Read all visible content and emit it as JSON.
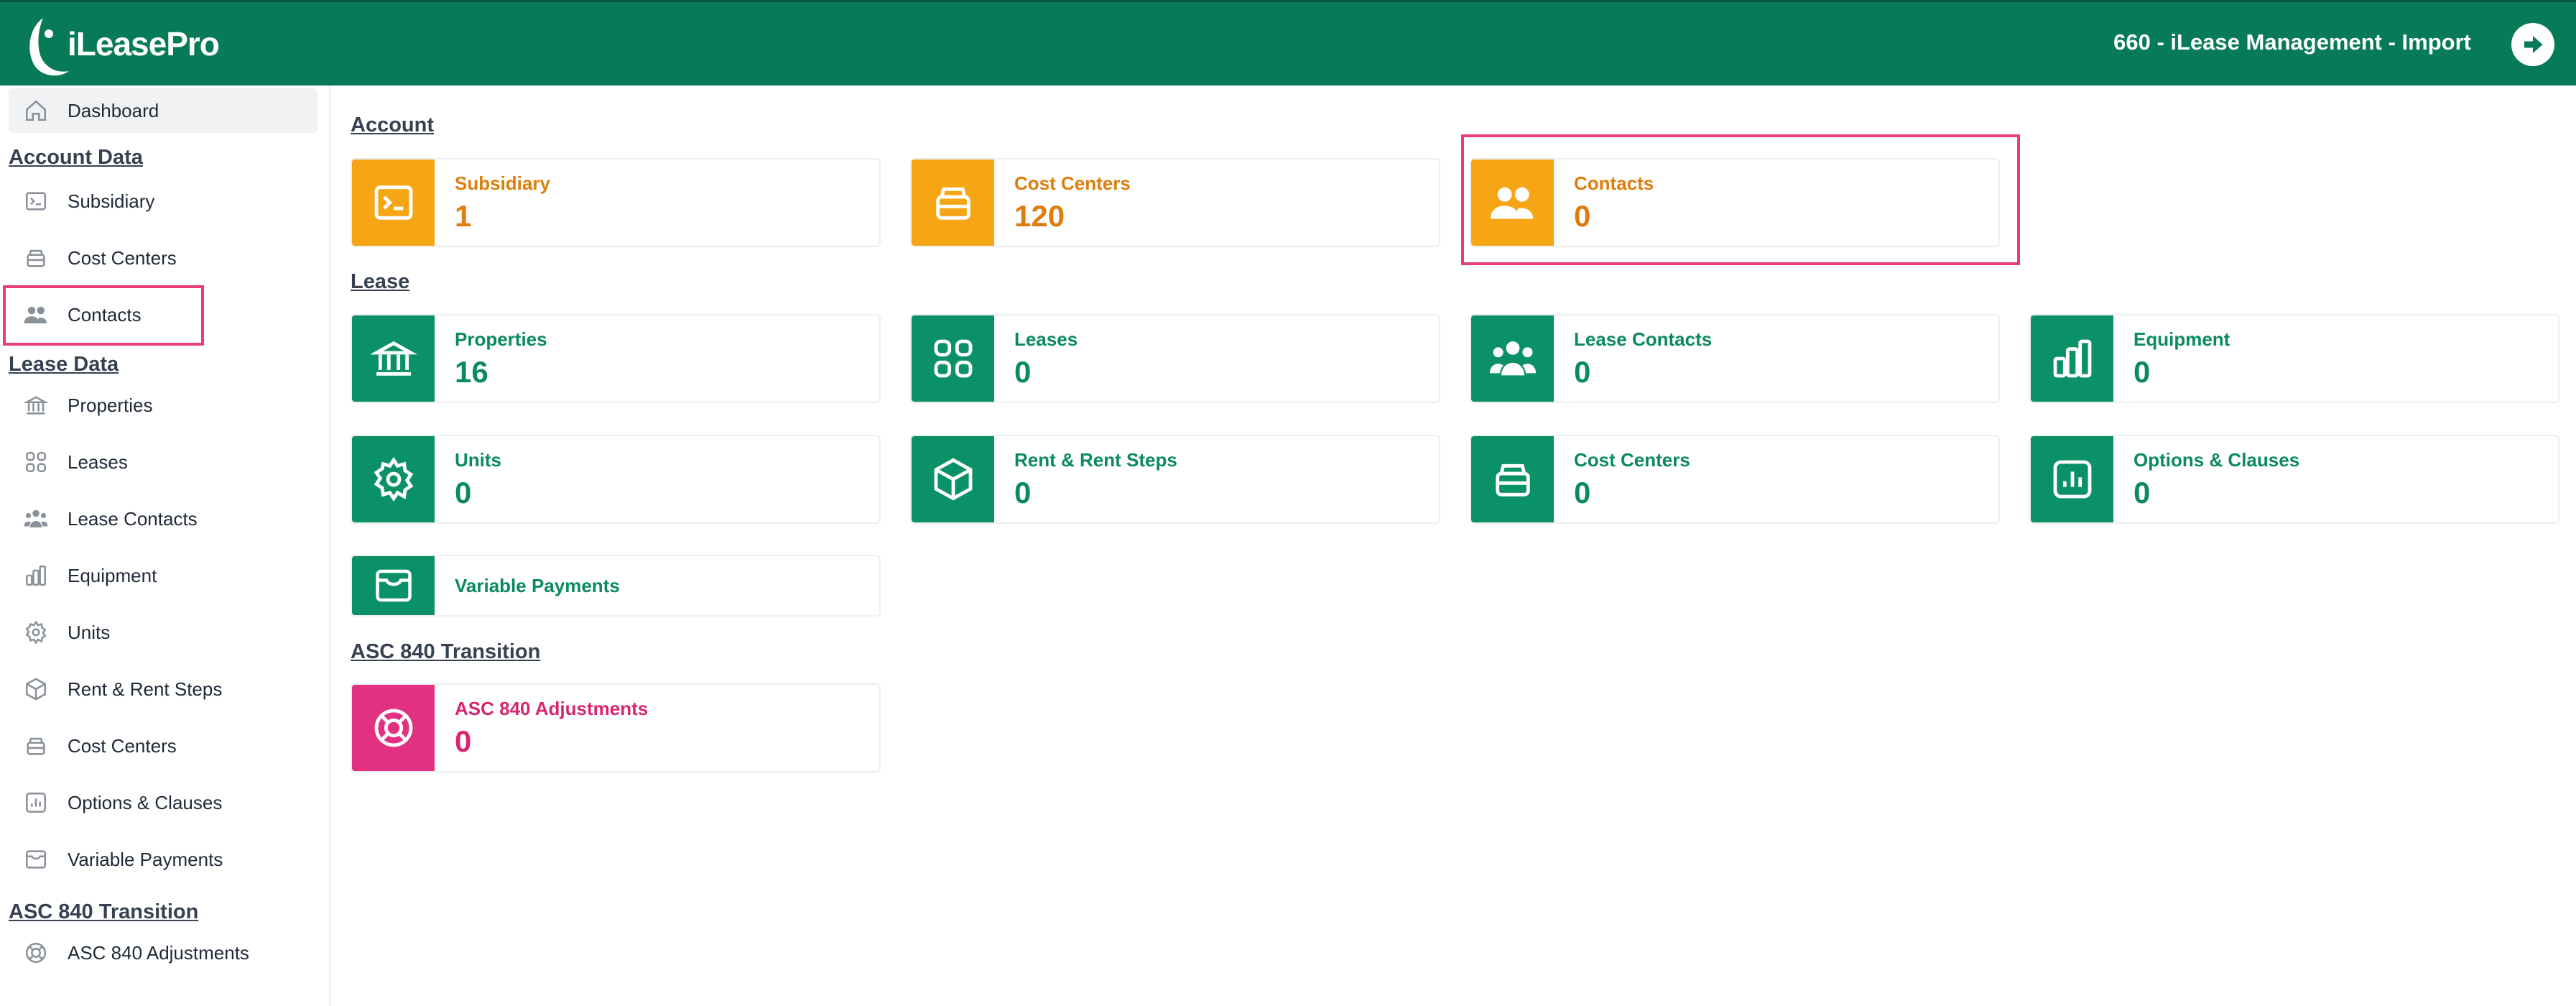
{
  "header": {
    "brand": "iLeasePro",
    "account_title": "660 - iLease Management - Import"
  },
  "sidebar": {
    "dashboard": "Dashboard",
    "account_heading": "Account Data",
    "account_items": [
      "Subsidiary",
      "Cost Centers",
      "Contacts"
    ],
    "lease_heading": "Lease Data",
    "lease_items": [
      "Properties",
      "Leases",
      "Lease Contacts",
      "Equipment",
      "Units",
      "Rent & Rent Steps",
      "Cost Centers",
      "Options & Clauses",
      "Variable Payments"
    ],
    "asc_heading": "ASC 840 Transition",
    "asc_items": [
      "ASC 840 Adjustments"
    ]
  },
  "main": {
    "account_title": "Account",
    "account_cards": [
      {
        "label": "Subsidiary",
        "value": "1",
        "icon": "terminal-icon"
      },
      {
        "label": "Cost Centers",
        "value": "120",
        "icon": "archive-icon"
      },
      {
        "label": "Contacts",
        "value": "0",
        "icon": "people-icon"
      }
    ],
    "lease_title": "Lease",
    "lease_cards": [
      {
        "label": "Properties",
        "value": "16",
        "icon": "bank-icon"
      },
      {
        "label": "Leases",
        "value": "0",
        "icon": "grid-icon"
      },
      {
        "label": "Lease Contacts",
        "value": "0",
        "icon": "group-icon"
      },
      {
        "label": "Equipment",
        "value": "0",
        "icon": "bar-chart-icon"
      },
      {
        "label": "Units",
        "value": "0",
        "icon": "gear-icon"
      },
      {
        "label": "Rent & Rent Steps",
        "value": "0",
        "icon": "box-icon"
      },
      {
        "label": "Cost Centers",
        "value": "0",
        "icon": "archive-icon"
      },
      {
        "label": "Options & Clauses",
        "value": "0",
        "icon": "chart-square-icon"
      },
      {
        "label": "Variable Payments",
        "icon": "wallet-icon"
      }
    ],
    "asc_title": "ASC 840 Transition",
    "asc_cards": [
      {
        "label": "ASC 840 Adjustments",
        "value": "0",
        "icon": "lifebuoy-icon"
      }
    ]
  },
  "colors": {
    "header_green": "#077a57",
    "account_orange": "#f6a615",
    "lease_green": "#0b9168",
    "asc_pink": "#e23180",
    "highlight": "#ea3d74"
  }
}
